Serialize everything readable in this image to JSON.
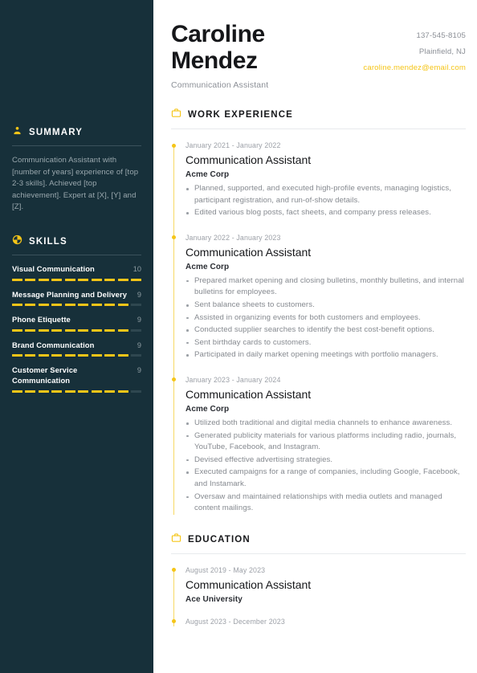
{
  "theme": {
    "sidebar_bg": "#17303a",
    "accent": "#f5c518",
    "page_bg": "#ffffff",
    "body_text": "#85898f",
    "heading_text": "#16171a"
  },
  "header": {
    "name_line1": "Caroline",
    "name_line2": "Mendez",
    "role": "Communication Assistant",
    "contact": {
      "phone": "137-545-8105",
      "location": "Plainfield, NJ",
      "email": "caroline.mendez@email.com"
    }
  },
  "sidebar": {
    "summary": {
      "icon": "user-icon",
      "title": "SUMMARY",
      "text": "Communication Assistant with [number of years] experience of [top 2-3 skills]. Achieved [top achievement]. Expert at [X], [Y] and [Z]."
    },
    "skills": {
      "icon": "pie-chart-icon",
      "title": "SKILLS",
      "max": 10,
      "items": [
        {
          "name": "Visual Communication",
          "value": "10",
          "level": 10
        },
        {
          "name": "Message Planning and Delivery",
          "value": "9",
          "level": 9
        },
        {
          "name": "Phone Etiquette",
          "value": "9",
          "level": 9
        },
        {
          "name": "Brand Communication",
          "value": "9",
          "level": 9
        },
        {
          "name": "Customer Service Communication",
          "value": "9",
          "level": 9
        }
      ]
    }
  },
  "work_experience": {
    "icon": "briefcase-icon",
    "title": "WORK EXPERIENCE",
    "entries": [
      {
        "date": "January 2021 - January 2022",
        "title": "Communication Assistant",
        "org": "Acme Corp",
        "bullets": [
          "Planned, supported, and executed high-profile events, managing logistics, participant registration, and run-of-show details.",
          "Edited various blog posts, fact sheets, and company press releases."
        ]
      },
      {
        "date": "January 2022 - January 2023",
        "title": "Communication Assistant",
        "org": "Acme Corp",
        "bullets": [
          "Prepared market opening and closing bulletins, monthly bulletins, and internal bulletins for employees.",
          "Sent balance sheets to customers.",
          "Assisted in organizing events for both customers and employees.",
          "Conducted supplier searches to identify the best cost-benefit options.",
          "Sent birthday cards to customers.",
          "Participated in daily market opening meetings with portfolio managers."
        ]
      },
      {
        "date": "January 2023 - January 2024",
        "title": "Communication Assistant",
        "org": "Acme Corp",
        "bullets": [
          "Utilized both traditional and digital media channels to enhance awareness.",
          "Generated publicity materials for various platforms including radio, journals, YouTube, Facebook, and Instagram.",
          "Devised effective advertising strategies.",
          "Executed campaigns for a range of companies, including Google, Facebook, and Instamark.",
          "Oversaw and maintained relationships with media outlets and managed content mailings."
        ]
      }
    ]
  },
  "education": {
    "icon": "briefcase-icon",
    "title": "EDUCATION",
    "entries": [
      {
        "date": "August 2019 - May 2023",
        "title": "Communication Assistant",
        "org": "Ace University"
      },
      {
        "date": "August 2023 - December 2023",
        "title": "",
        "org": ""
      }
    ]
  }
}
